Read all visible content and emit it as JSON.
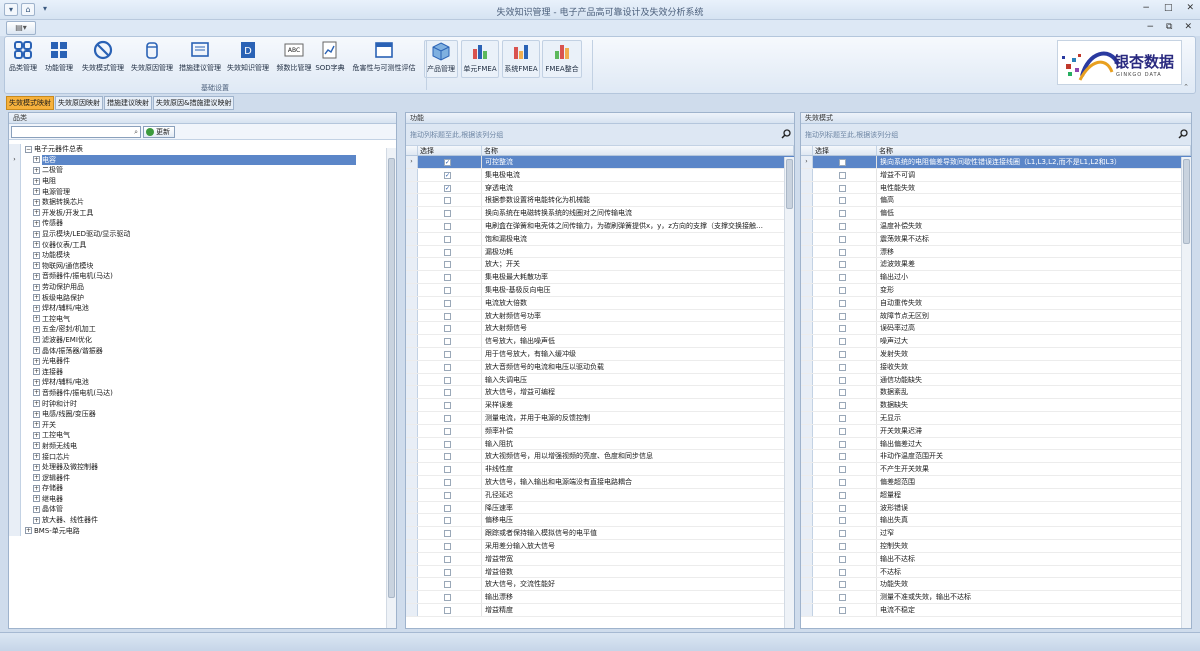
{
  "window": {
    "title": "失效知识管理 - 电子产品高可靠设计及失效分析系统"
  },
  "ribbon": {
    "buttons": [
      {
        "label": "品类管理",
        "icon": "grid-icon"
      },
      {
        "label": "功能管理",
        "icon": "blocks-icon"
      },
      {
        "label": "失效模式管理",
        "icon": "ban-icon"
      },
      {
        "label": "失效原因管理",
        "icon": "cylinder-icon"
      },
      {
        "label": "措施建议管理",
        "icon": "board-icon"
      },
      {
        "label": "失效知识管理",
        "icon": "d-doc-icon"
      },
      {
        "label": "频数比管理",
        "icon": "abc-icon"
      },
      {
        "label": "SOD字典",
        "icon": "chart-doc-icon"
      },
      {
        "label": "危害性与可测性评估",
        "icon": "window-icon"
      },
      {
        "label": "产品管理",
        "icon": "cube-icon"
      },
      {
        "label": "单元FMEA",
        "icon": "bars-icon"
      },
      {
        "label": "系统FMEA",
        "icon": "bars2-icon"
      },
      {
        "label": "FMEA整合",
        "icon": "bars3-icon"
      }
    ],
    "group_label": "基础设置"
  },
  "logo": {
    "cn": "银杏数据",
    "en": "GINKGO DATA"
  },
  "doc_tabs": [
    "失效模式映射",
    "失效原因映射",
    "措施建议映射",
    "失效原因&措施建议映射"
  ],
  "panels": {
    "category": {
      "header": "品类",
      "refresh_label": "更新",
      "tree": [
        {
          "label": "电子元器件总表",
          "level": 0,
          "sign": "−"
        },
        {
          "label": "电容",
          "level": 1,
          "sign": "+",
          "selected": true
        },
        {
          "label": "二极管",
          "level": 1,
          "sign": "+"
        },
        {
          "label": "电阻",
          "level": 1,
          "sign": "+"
        },
        {
          "label": "电源管理",
          "level": 1,
          "sign": "+"
        },
        {
          "label": "数据转换芯片",
          "level": 1,
          "sign": "+"
        },
        {
          "label": "开发板/开发工具",
          "level": 1,
          "sign": "+"
        },
        {
          "label": "传感器",
          "level": 1,
          "sign": "+"
        },
        {
          "label": "显示模块/LED驱动/显示驱动",
          "level": 1,
          "sign": "+"
        },
        {
          "label": "仪器仪表/工具",
          "level": 1,
          "sign": "+"
        },
        {
          "label": "功能模块",
          "level": 1,
          "sign": "+"
        },
        {
          "label": "物联网/通信模块",
          "level": 1,
          "sign": "+"
        },
        {
          "label": "音频器件/振电机(马达)",
          "level": 1,
          "sign": "+"
        },
        {
          "label": "劳动保护用品",
          "level": 1,
          "sign": "+"
        },
        {
          "label": "板级电路保护",
          "level": 1,
          "sign": "+"
        },
        {
          "label": "焊材/辅料/电池",
          "level": 1,
          "sign": "+"
        },
        {
          "label": "工控电气",
          "level": 1,
          "sign": "+"
        },
        {
          "label": "五金/密封/机加工",
          "level": 1,
          "sign": "+"
        },
        {
          "label": "滤波器/EMI优化",
          "level": 1,
          "sign": "+"
        },
        {
          "label": "晶体/振荡器/谐振器",
          "level": 1,
          "sign": "+"
        },
        {
          "label": "光电器件",
          "level": 1,
          "sign": "+"
        },
        {
          "label": "连接器",
          "level": 1,
          "sign": "+"
        },
        {
          "label": "焊材/辅料/电池",
          "level": 1,
          "sign": "+"
        },
        {
          "label": "音频器件/振电机(马达)",
          "level": 1,
          "sign": "+"
        },
        {
          "label": "时钟和计时",
          "level": 1,
          "sign": "+"
        },
        {
          "label": "电感/线圈/变压器",
          "level": 1,
          "sign": "+"
        },
        {
          "label": "开关",
          "level": 1,
          "sign": "+"
        },
        {
          "label": "工控电气",
          "level": 1,
          "sign": "+"
        },
        {
          "label": "射频无线电",
          "level": 1,
          "sign": "+"
        },
        {
          "label": "接口芯片",
          "level": 1,
          "sign": "+"
        },
        {
          "label": "处理器及微控制器",
          "level": 1,
          "sign": "+"
        },
        {
          "label": "逻辑器件",
          "level": 1,
          "sign": "+"
        },
        {
          "label": "存储器",
          "level": 1,
          "sign": "+"
        },
        {
          "label": "继电器",
          "level": 1,
          "sign": "+"
        },
        {
          "label": "晶体管",
          "level": 1,
          "sign": "+"
        },
        {
          "label": "放大器、线性器件",
          "level": 1,
          "sign": "+"
        },
        {
          "label": "BMS-单元电路",
          "level": 0,
          "sign": "+"
        }
      ]
    },
    "function": {
      "header": "功能",
      "group_hint": "拖动列标题至此,根据该列分组",
      "col_select": "选择",
      "col_name": "名称",
      "rows": [
        {
          "name": "可控整流",
          "checked": true,
          "selected": true
        },
        {
          "name": "集电极电流",
          "checked": true
        },
        {
          "name": "穿透电流",
          "checked": true
        },
        {
          "name": "根据参数设置将电能转化为机械能",
          "checked": false
        },
        {
          "name": "换向系统在电磁转换系统的线圈对之间传输电流",
          "checked": false
        },
        {
          "name": "电刷盒在弹簧和电壳体之间传输力，为碳刷弹簧提供x，y，z方向的支撑（支撑交换接触…",
          "checked": false
        },
        {
          "name": "饱和漏极电流",
          "checked": false
        },
        {
          "name": "漏极功耗",
          "checked": false
        },
        {
          "name": "放大；开关",
          "checked": false
        },
        {
          "name": "集电极最大耗散功率",
          "checked": false
        },
        {
          "name": "集电极-基极反向电压",
          "checked": false
        },
        {
          "name": "电流放大倍数",
          "checked": false
        },
        {
          "name": "放大射频信号功率",
          "checked": false
        },
        {
          "name": "放大射频信号",
          "checked": false
        },
        {
          "name": "信号放大，输出噪声低",
          "checked": false
        },
        {
          "name": "用于信号放大，有输入缓冲级",
          "checked": false
        },
        {
          "name": "放大音频信号的电流和电压以驱动负载",
          "checked": false
        },
        {
          "name": "输入失调电压",
          "checked": false
        },
        {
          "name": "放大信号，增益可编程",
          "checked": false
        },
        {
          "name": "采样误差",
          "checked": false
        },
        {
          "name": "测量电流，并用于电源的反馈控制",
          "checked": false
        },
        {
          "name": "频率补偿",
          "checked": false
        },
        {
          "name": "输入阻抗",
          "checked": false
        },
        {
          "name": "放大视频信号，用以增强视频的亮度、色度和同步信息",
          "checked": false
        },
        {
          "name": "非线性度",
          "checked": false
        },
        {
          "name": "放大信号，输入输出和电源端没有直接电路耦合",
          "checked": false
        },
        {
          "name": "孔径延迟",
          "checked": false
        },
        {
          "name": "降压速率",
          "checked": false
        },
        {
          "name": "偏移电压",
          "checked": false
        },
        {
          "name": "跟踪或者保持输入模拟信号的电平值",
          "checked": false
        },
        {
          "name": "采用差分输入放大信号",
          "checked": false
        },
        {
          "name": "增益带宽",
          "checked": false
        },
        {
          "name": "增益倍数",
          "checked": false
        },
        {
          "name": "放大信号，交流性能好",
          "checked": false
        },
        {
          "name": "输出漂移",
          "checked": false
        },
        {
          "name": "增益精度",
          "checked": false
        }
      ]
    },
    "failure_mode": {
      "header": "失效模式",
      "group_hint": "拖动列标题至此,根据该列分组",
      "col_select": "选择",
      "col_name": "名称",
      "rows": [
        {
          "name": "换向系统的电阻偏差导致间歇性错误连接线圈（L1,L3,L2,而不是L1,L2和L3）",
          "checked": false,
          "selected": true
        },
        {
          "name": "增益不可调",
          "checked": false
        },
        {
          "name": "电性能失效",
          "checked": false
        },
        {
          "name": "偏高",
          "checked": false
        },
        {
          "name": "偏低",
          "checked": false
        },
        {
          "name": "温度补偿失效",
          "checked": false
        },
        {
          "name": "震荡效果不达标",
          "checked": false
        },
        {
          "name": "漂移",
          "checked": false
        },
        {
          "name": "滤波效果差",
          "checked": false
        },
        {
          "name": "输出过小",
          "checked": false
        },
        {
          "name": "变形",
          "checked": false
        },
        {
          "name": "自动重传失效",
          "checked": false
        },
        {
          "name": "故障节点无区别",
          "checked": false
        },
        {
          "name": "误码率过高",
          "checked": false
        },
        {
          "name": "噪声过大",
          "checked": false
        },
        {
          "name": "发射失效",
          "checked": false
        },
        {
          "name": "接收失效",
          "checked": false
        },
        {
          "name": "通信功能缺失",
          "checked": false
        },
        {
          "name": "数据紊乱",
          "checked": false
        },
        {
          "name": "数据缺失",
          "checked": false
        },
        {
          "name": "无显示",
          "checked": false
        },
        {
          "name": "开关效果迟滞",
          "checked": false
        },
        {
          "name": "输出偏差过大",
          "checked": false
        },
        {
          "name": "非动作温度范围开关",
          "checked": false
        },
        {
          "name": "不产生开关效果",
          "checked": false
        },
        {
          "name": "偏差超范围",
          "checked": false
        },
        {
          "name": "超量程",
          "checked": false
        },
        {
          "name": "波形错误",
          "checked": false
        },
        {
          "name": "输出失真",
          "checked": false
        },
        {
          "name": "过窄",
          "checked": false
        },
        {
          "name": "控制失效",
          "checked": false
        },
        {
          "name": "输出不达标",
          "checked": false
        },
        {
          "name": "不达标",
          "checked": false
        },
        {
          "name": "功能失效",
          "checked": false
        },
        {
          "name": "测量不准或失效，输出不达标",
          "checked": false
        },
        {
          "name": "电流不稳定",
          "checked": false
        }
      ]
    }
  },
  "colors": {
    "selection": "#5b86c8",
    "active_tab": "#f6b13c"
  }
}
